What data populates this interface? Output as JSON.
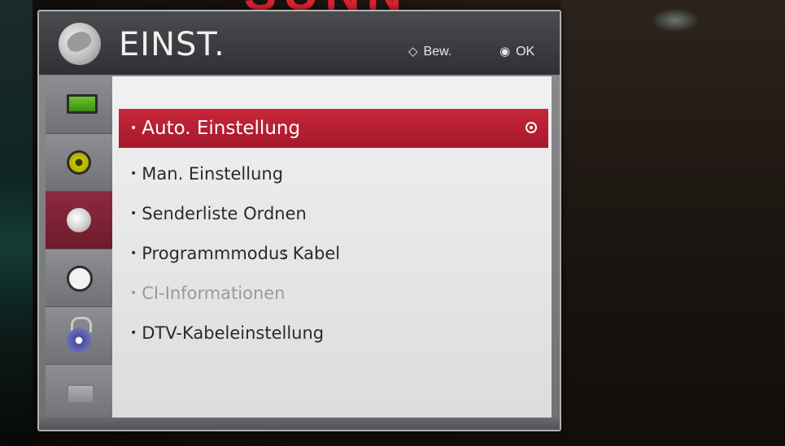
{
  "top_text": "SUNN",
  "header": {
    "title": "EINST.",
    "move_hint": "Bew.",
    "move_glyph": "◇",
    "ok_hint": "OK",
    "ok_glyph": "◉"
  },
  "sidebar": {
    "items": [
      {
        "icon": "tv-icon",
        "active": false
      },
      {
        "icon": "speaker-icon",
        "active": false
      },
      {
        "icon": "satellite-dish-icon",
        "active": true
      },
      {
        "icon": "clock-icon",
        "active": false
      },
      {
        "icon": "lock-icon",
        "active": false
      },
      {
        "icon": "toolbox-icon",
        "active": false
      }
    ]
  },
  "menu": {
    "items": [
      {
        "label": "Auto. Einstellung",
        "state": "selected",
        "value": ""
      },
      {
        "label": "Man. Einstellung",
        "state": "normal",
        "value": ""
      },
      {
        "label": "Senderliste Ordnen",
        "state": "normal",
        "value": ""
      },
      {
        "label": "Programmmodus",
        "state": "normal",
        "value": ": Kabel"
      },
      {
        "label": "CI-Informationen",
        "state": "disabled",
        "value": ""
      },
      {
        "label": "DTV-Kabeleinstellung",
        "state": "normal",
        "value": ""
      }
    ],
    "bullet": "•"
  },
  "colors": {
    "selection": "#c7263a",
    "active_sidebar": "#8c2a3e",
    "header_bg": "#3a3c3f"
  }
}
